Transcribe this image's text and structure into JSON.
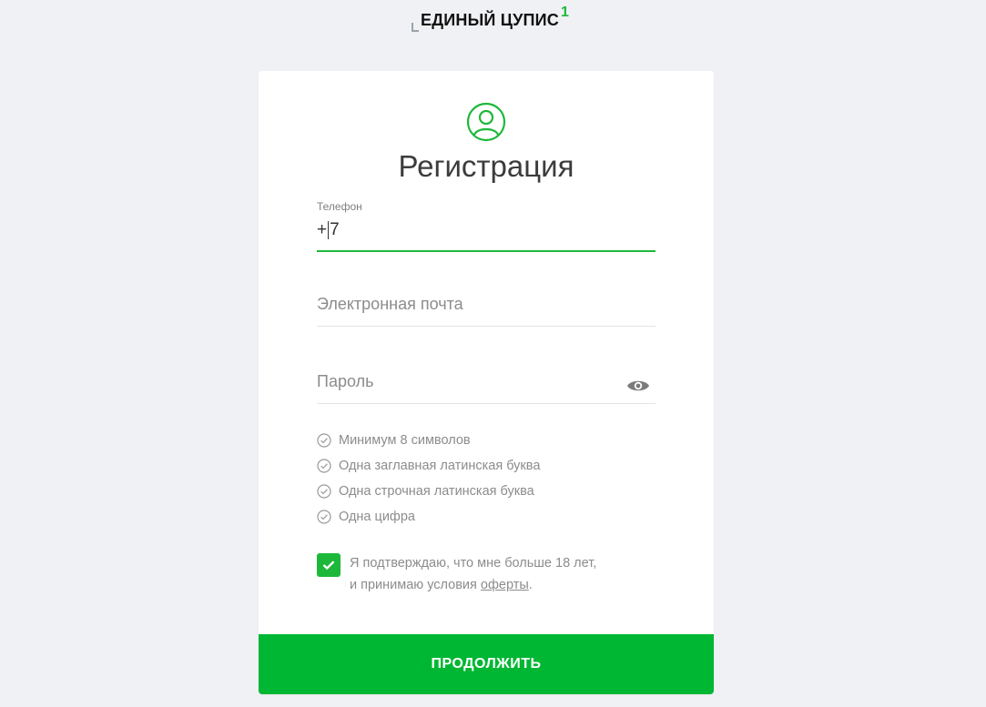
{
  "brand": {
    "name": "ЕДИНЫЙ ЦУПИС",
    "sup": "1",
    "accent": "#1db83a"
  },
  "form": {
    "title": "Регистрация",
    "user_icon": "user-circle-icon",
    "phone": {
      "label": "Телефон",
      "prefix": "+",
      "value": "7"
    },
    "email": {
      "placeholder": "Электронная почта"
    },
    "password": {
      "placeholder": "Пароль",
      "toggle_icon": "eye-icon"
    },
    "rules": [
      {
        "text": "Минимум 8 символов"
      },
      {
        "text": "Одна заглавная латинская буква"
      },
      {
        "text": "Одна строчная латинская буква"
      },
      {
        "text": "Одна цифра"
      }
    ],
    "consent": {
      "checked": true,
      "line1": "Я подтверждаю, что мне больше 18 лет,",
      "line2_prefix": "и принимаю условия ",
      "link": "оферты",
      "line2_suffix": "."
    },
    "submit_label": "ПРОДОЛЖИТЬ",
    "submit_color": "#00b733"
  }
}
